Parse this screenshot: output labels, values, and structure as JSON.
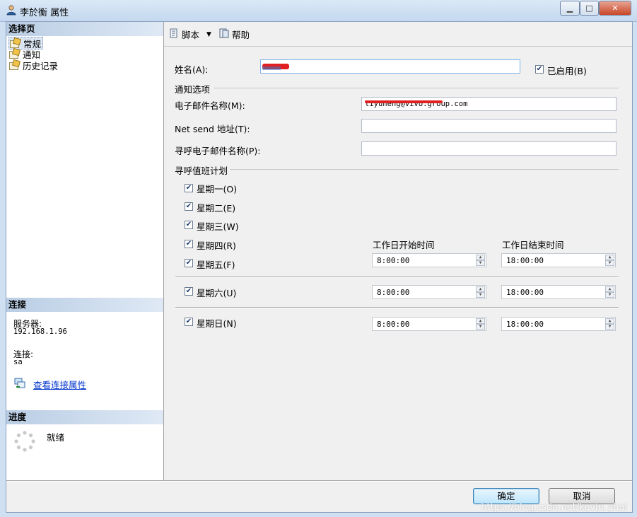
{
  "window": {
    "title": "李於衡 属性",
    "minimize_icon": "minimize-icon",
    "maximize_icon": "maximize-icon",
    "close_icon": "close-icon"
  },
  "left_pane": {
    "pages_header": "选择页",
    "pages": [
      {
        "label": "常规",
        "icon": "page-wrench-icon"
      },
      {
        "label": "通知",
        "icon": "page-wrench-icon"
      },
      {
        "label": "历史记录",
        "icon": "page-wrench-icon"
      }
    ],
    "connection_header": "连接",
    "server_label": "服务器:",
    "server_value": "192.168.1.96",
    "connection_label": "连接:",
    "connection_value": "sa",
    "view_connection_link": "查看连接属性",
    "progress_header": "进度",
    "progress_status": "就绪"
  },
  "toolbar": {
    "script_label": "脚本",
    "help_label": "帮助"
  },
  "form": {
    "name_label": "姓名(A):",
    "name_value": "",
    "enabled_label": "已启用(B)",
    "enabled": true,
    "notification_group": "通知选项",
    "email_label": "电子邮件名称(M):",
    "email_value": "liyuheng@vivo.group.com",
    "netsend_label": "Net send 地址(T):",
    "netsend_value": "",
    "pager_email_label": "寻呼电子邮件名称(P):",
    "pager_email_value": "",
    "schedule_group": "寻呼值班计划",
    "days": [
      {
        "label": "星期一(O)",
        "checked": true
      },
      {
        "label": "星期二(E)",
        "checked": true
      },
      {
        "label": "星期三(W)",
        "checked": true
      },
      {
        "label": "星期四(R)",
        "checked": true
      },
      {
        "label": "星期五(F)",
        "checked": true
      },
      {
        "label": "星期六(U)",
        "checked": true
      },
      {
        "label": "星期日(N)",
        "checked": true
      }
    ],
    "workday_start_header": "工作日开始时间",
    "workday_end_header": "工作日结束时间",
    "weekday_start": "8:00:00",
    "weekday_end": "18:00:00",
    "saturday_start": "8:00:00",
    "saturday_end": "18:00:00",
    "sunday_start": "8:00:00",
    "sunday_end": "18:00:00"
  },
  "buttons": {
    "ok": "确定",
    "cancel": "取消"
  },
  "watermark": "https://blog.csdn.net/kevin_zhai"
}
